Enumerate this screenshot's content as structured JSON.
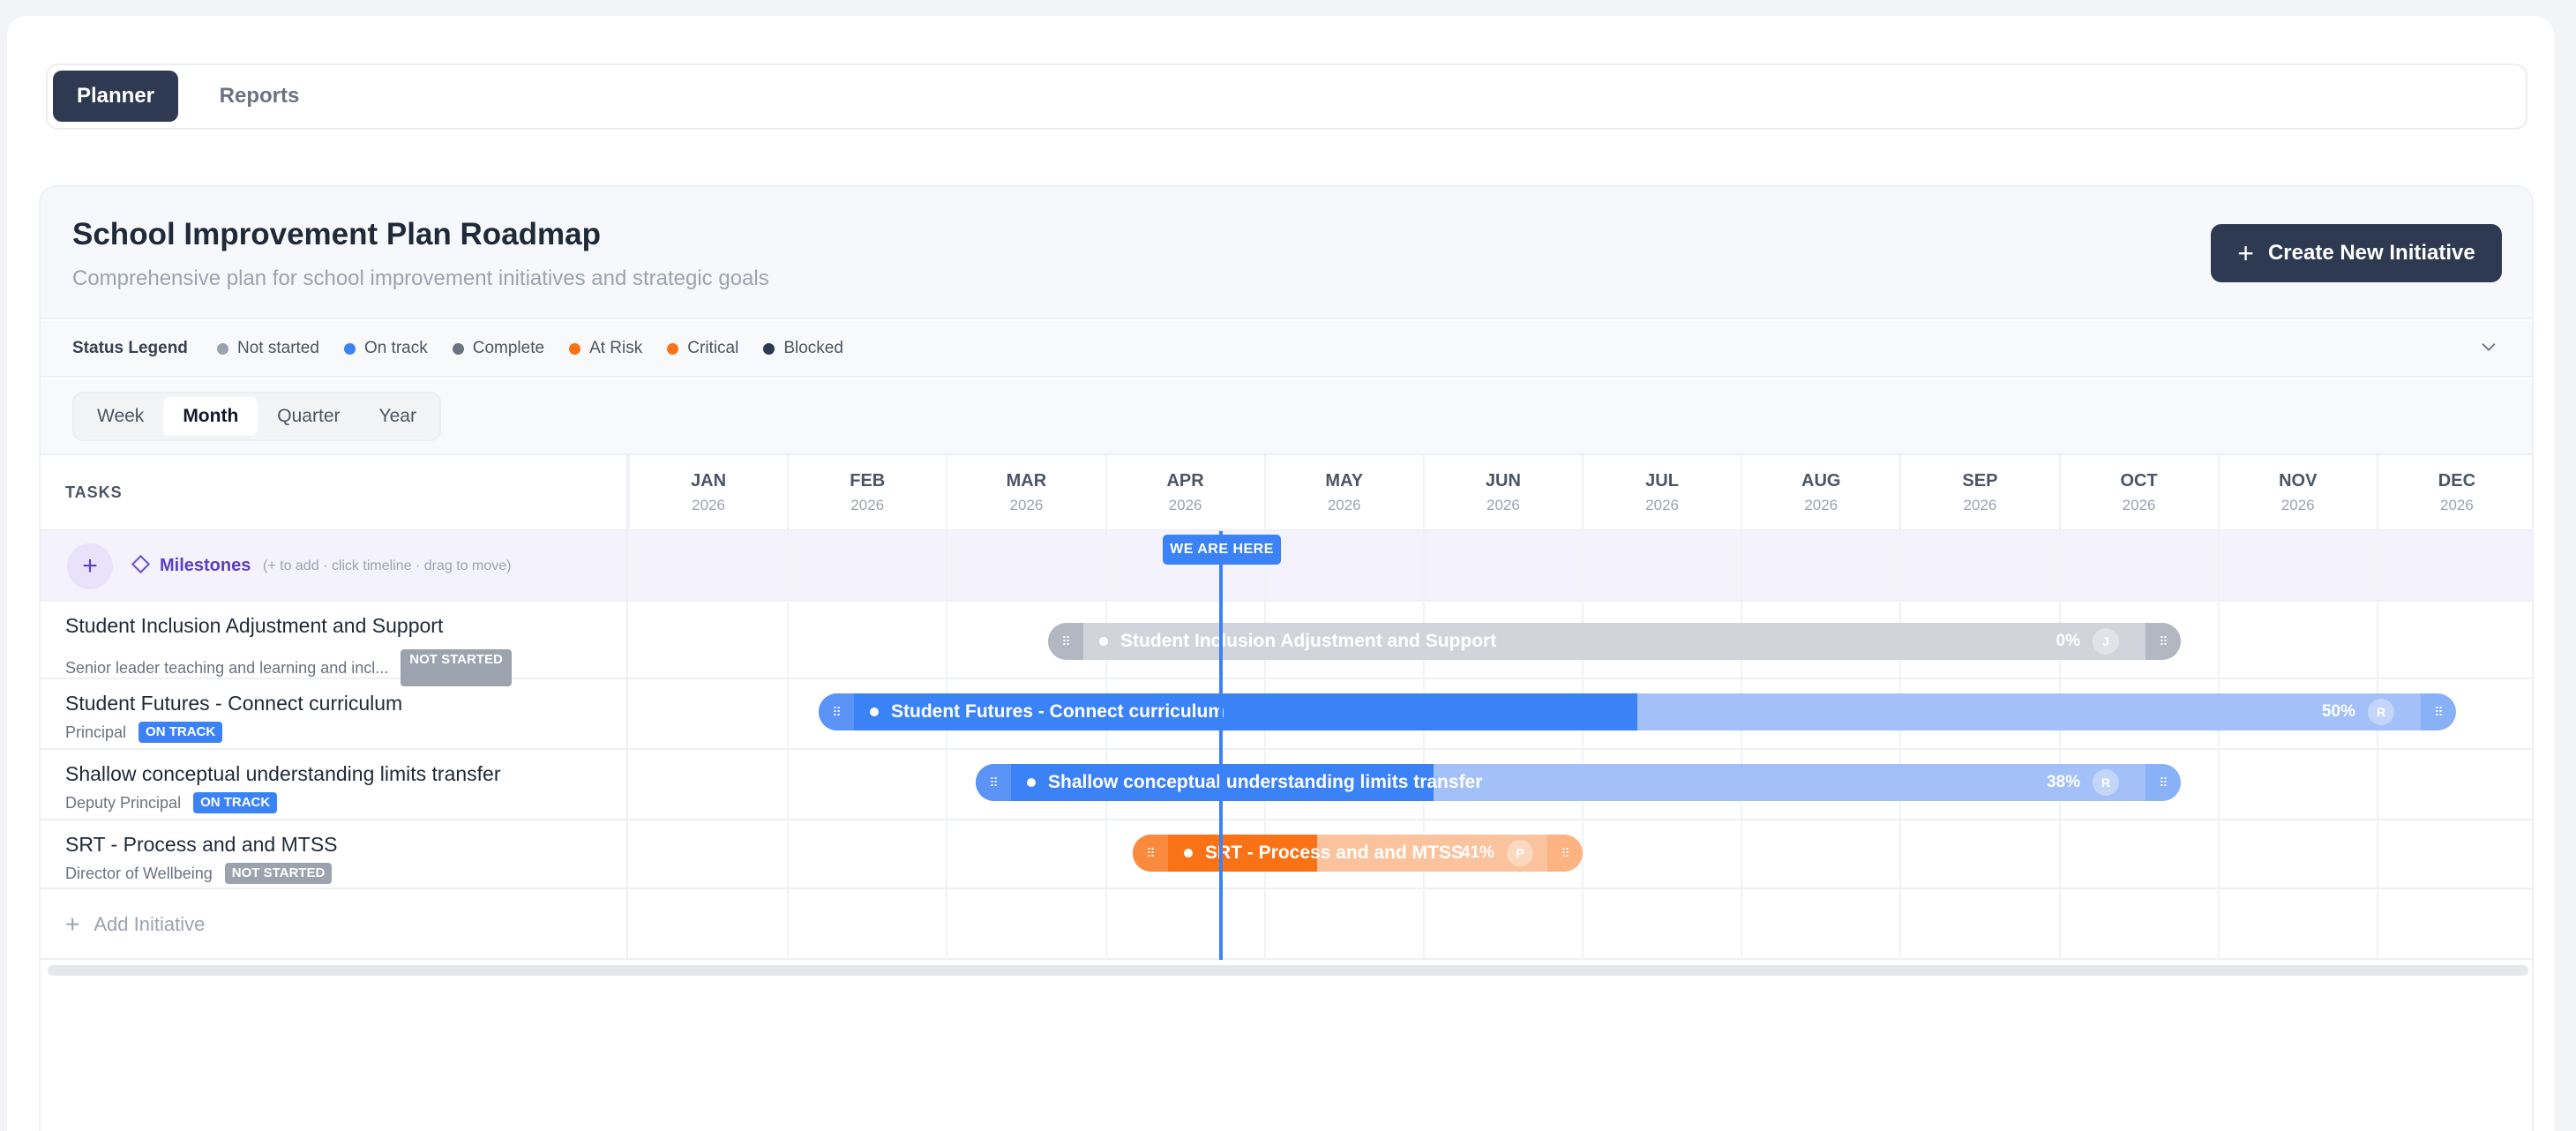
{
  "tabs": [
    {
      "label": "Planner"
    },
    {
      "label": "Reports"
    }
  ],
  "header": {
    "title": "School Improvement Plan Roadmap",
    "subtitle": "Comprehensive plan for school improvement initiatives and strategic goals",
    "create_label": "Create New Initiative",
    "create_icon": "plus-icon"
  },
  "legend": {
    "title": "Status Legend",
    "items": [
      {
        "label": "Not started",
        "color": "#9ca3af"
      },
      {
        "label": "On track",
        "color": "#3b82f6"
      },
      {
        "label": "Complete",
        "color": "#6b7280"
      },
      {
        "label": "At Risk",
        "color": "#f97316"
      },
      {
        "label": "Critical",
        "color": "#f97316"
      },
      {
        "label": "Blocked",
        "color": "#2e3a52"
      }
    ]
  },
  "zoom": {
    "options": [
      "Week",
      "Month",
      "Quarter",
      "Year"
    ],
    "selected": "Month"
  },
  "grid": {
    "tasks_header": "TASKS",
    "months": [
      {
        "m": "JAN",
        "y": "2026"
      },
      {
        "m": "FEB",
        "y": "2026"
      },
      {
        "m": "MAR",
        "y": "2026"
      },
      {
        "m": "APR",
        "y": "2026"
      },
      {
        "m": "MAY",
        "y": "2026"
      },
      {
        "m": "JUN",
        "y": "2026"
      },
      {
        "m": "JUL",
        "y": "2026"
      },
      {
        "m": "AUG",
        "y": "2026"
      },
      {
        "m": "SEP",
        "y": "2026"
      },
      {
        "m": "OCT",
        "y": "2026"
      },
      {
        "m": "NOV",
        "y": "2026"
      },
      {
        "m": "DEC",
        "y": "2026"
      }
    ],
    "today_label": "WE ARE HERE",
    "milestones": {
      "label": "Milestones",
      "hint": "(+ to add · click timeline · drag to move)"
    },
    "tasks": [
      {
        "name": "Student Inclusion Adjustment and Support",
        "owner": "Senior leader teaching and learning and incl...",
        "status": "NOT STARTED",
        "bar_label": "Student Inclusion Adjustment and Support",
        "progress_label": "0%",
        "progress": 0,
        "avatar": "J"
      },
      {
        "name": "Student Futures - Connect curriculum",
        "owner": "Principal",
        "status": "ON TRACK",
        "bar_label": "Student Futures - Connect curriculum",
        "progress_label": "50%",
        "progress": 50,
        "avatar": "R"
      },
      {
        "name": "Shallow conceptual understanding limits transfer",
        "owner": "Deputy Principal",
        "status": "ON TRACK",
        "bar_label": "Shallow conceptual understanding limits transfer",
        "progress_label": "38%",
        "progress": 38,
        "avatar": "R"
      },
      {
        "name": "SRT - Process and and MTSS",
        "owner": "Director of Wellbeing",
        "status": "NOT STARTED",
        "bar_label": "SRT - Process and and MTSS",
        "progress_label": "41%",
        "progress": 41,
        "avatar": "P"
      }
    ],
    "add_label": "Add Initiative"
  }
}
